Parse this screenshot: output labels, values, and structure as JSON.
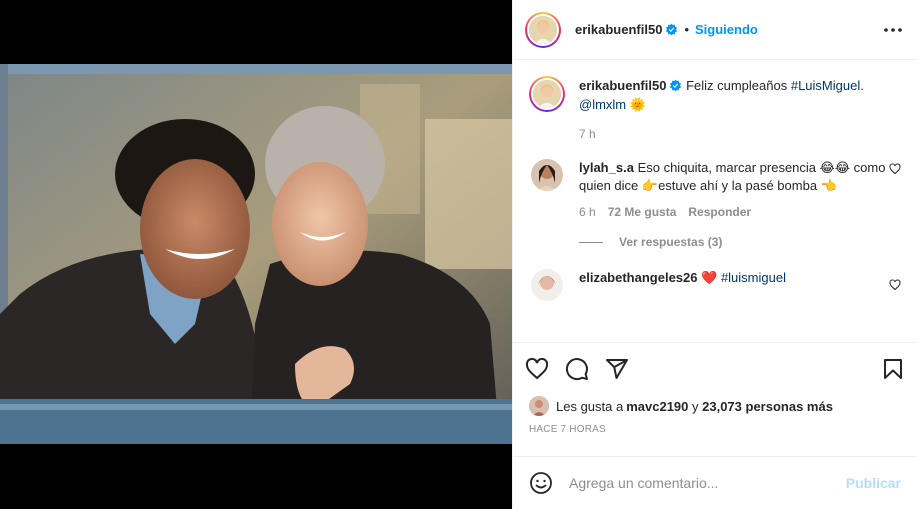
{
  "post": {
    "username": "erikabuenfil50",
    "follow_status": "Siguiendo",
    "separator": "•",
    "caption_text": "Feliz cumpleaños ",
    "caption_hashtag": "#LuisMiguel.",
    "caption_mention": "@lmxlm",
    "caption_emoji": "🌞",
    "caption_time": "7 h"
  },
  "comments": [
    {
      "username": "lylah_s.a",
      "text": "Eso chiquita, marcar presencia 😂😂 como quien dice 👉estuve ahí y la pasé bomba 👈",
      "time": "6 h",
      "likes": "72 Me gusta",
      "reply_label": "Responder",
      "view_replies": "Ver respuestas (3)"
    },
    {
      "username": "elizabethangeles26",
      "emoji": "❤️",
      "hashtag": "#luismiguel"
    }
  ],
  "likes": {
    "prefix": "Les gusta a ",
    "user": "mavc2190",
    "middle": " y ",
    "count": "23,073 personas más"
  },
  "timestamp": "HACE 7 HORAS",
  "comment_box": {
    "placeholder": "Agrega un comentario...",
    "publish_label": "Publicar"
  },
  "colors": {
    "accent": "#0095f6",
    "publish_disabled": "#b2dffc",
    "verified": "#0095f6",
    "heart_red": "#ed4956"
  },
  "icons": [
    "heart-icon",
    "comment-icon",
    "share-icon",
    "save-icon",
    "more-icon",
    "emoji-icon",
    "verified-icon"
  ]
}
